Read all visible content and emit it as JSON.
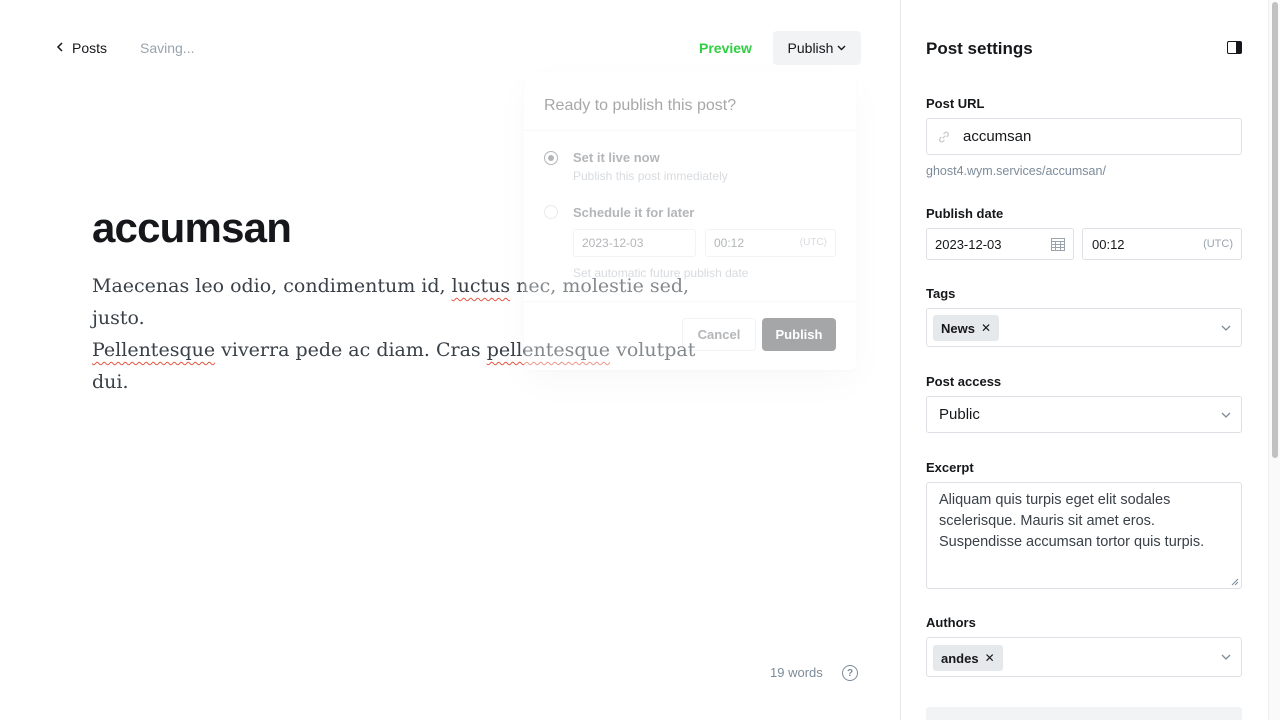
{
  "topbar": {
    "back_label": "Posts",
    "status": "Saving...",
    "preview_label": "Preview",
    "publish_label": "Publish"
  },
  "post": {
    "title": "accumsan",
    "body_parts": [
      "Maecenas leo odio, condimentum id, ",
      "luctus",
      " nec, molestie sed, justo.",
      "Pellentesque",
      " viverra pede ac diam. Cras ",
      "pellentesque",
      " volutpat dui."
    ],
    "word_count": "19 words"
  },
  "publish_menu": {
    "heading": "Ready to publish this post?",
    "option_now_title": "Set it live now",
    "option_now_desc": "Publish this post immediately",
    "option_later_title": "Schedule it for later",
    "option_later_desc": "Set automatic future publish date",
    "date": "2023-12-03",
    "time": "00:12",
    "tz": "(UTC)",
    "cancel_label": "Cancel",
    "confirm_label": "Publish"
  },
  "settings": {
    "title": "Post settings",
    "url_label": "Post URL",
    "url_value": "accumsan",
    "url_hint": "ghost4.wym.services/accumsan/",
    "date_label": "Publish date",
    "date_value": "2023-12-03",
    "time_value": "00:12",
    "tz": "(UTC)",
    "tags_label": "Tags",
    "tags": [
      "News"
    ],
    "access_label": "Post access",
    "access_value": "Public",
    "excerpt_label": "Excerpt",
    "excerpt_value": "Aliquam quis turpis eget elit sodales scelerisque. Mauris sit amet eros. Suspendisse accumsan tortor quis turpis.",
    "authors_label": "Authors",
    "authors": [
      "andes"
    ]
  },
  "colors": {
    "accent_green": "#30cf43",
    "text_dark": "#15171a",
    "muted": "#7c8b9a",
    "border": "#dde1e5",
    "token_bg": "#e6e9eb"
  },
  "icons": [
    "chevron-left-icon",
    "chevron-down-icon",
    "help-icon",
    "link-icon",
    "calendar-icon",
    "close-icon",
    "sidebar-toggle-icon",
    "resize-grip-icon"
  ]
}
